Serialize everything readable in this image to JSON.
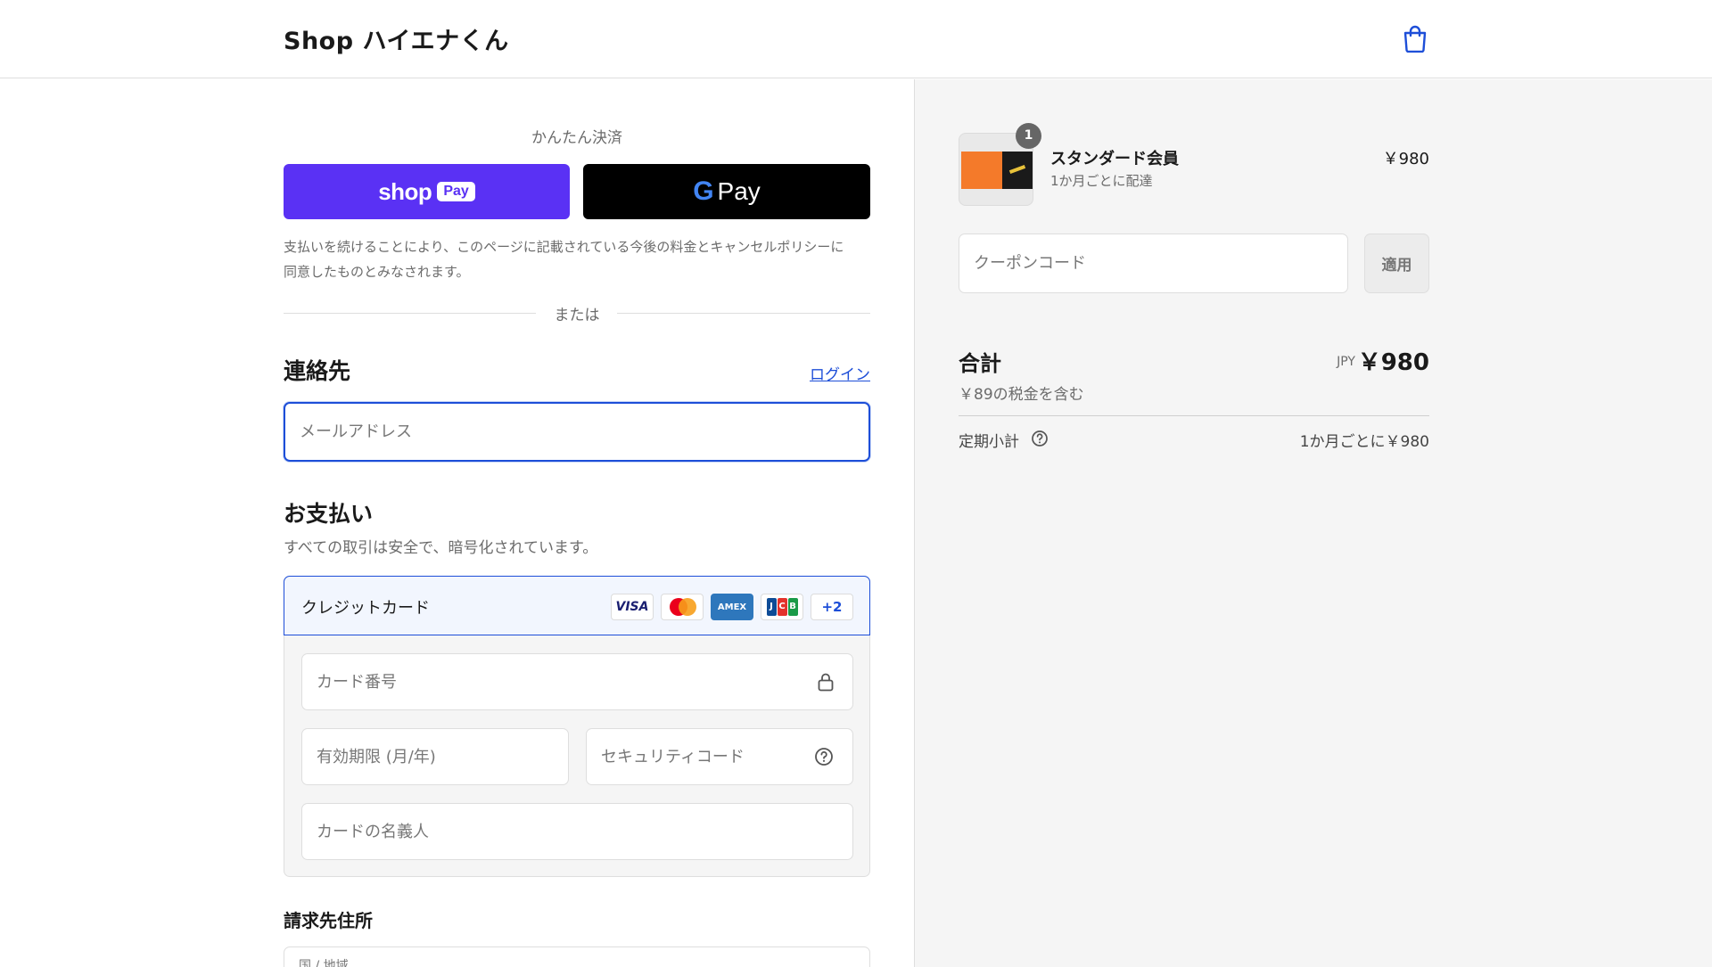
{
  "header": {
    "shop_title": "Shop ハイエナくん"
  },
  "express": {
    "label": "かんたん決済",
    "shoppay_shop": "shop",
    "shoppay_pay": "Pay",
    "gpay_g": "G",
    "gpay_pay": "Pay",
    "notice_line1": "支払いを続けることにより、このページに記載されている今後の料金とキャンセルポリシーに",
    "notice_line2": "同意したものとみなされます。",
    "or": "または"
  },
  "contact": {
    "title": "連絡先",
    "login": "ログイン",
    "email_placeholder": "メールアドレス"
  },
  "payment": {
    "title": "お支払い",
    "subtitle": "すべての取引は安全で、暗号化されています。",
    "method_label": "クレジットカード",
    "brands": {
      "visa": "VISA",
      "amex": "AMEX",
      "jcb_j": "J",
      "jcb_c": "C",
      "jcb_b": "B",
      "more": "+2"
    },
    "card_number_placeholder": "カード番号",
    "expiry_placeholder": "有効期限 (月/年)",
    "security_placeholder": "セキュリティコード",
    "name_placeholder": "カードの名義人"
  },
  "billing": {
    "title": "請求先住所",
    "country_label": "国 / 地域"
  },
  "summary": {
    "qty": "1",
    "product_name": "スタンダード会員",
    "product_sub": "1か月ごとに配達",
    "product_price": "￥980",
    "coupon_placeholder": "クーポンコード",
    "apply": "適用",
    "total_label": "合計",
    "currency": "JPY",
    "total_amount": "￥980",
    "tax_text": "￥89の税金を含む",
    "recurring_label": "定期小計",
    "recurring_value": "1か月ごとに￥980"
  },
  "colors": {
    "shoppay": "#5a31f4",
    "accent": "#1d4ed8",
    "panel_bg": "#f5f5f5"
  }
}
